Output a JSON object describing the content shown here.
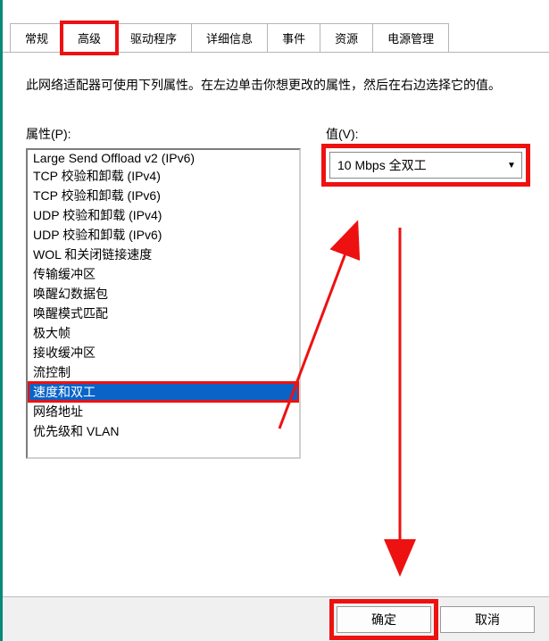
{
  "tabs": [
    {
      "label": "常规"
    },
    {
      "label": "高级"
    },
    {
      "label": "驱动程序"
    },
    {
      "label": "详细信息"
    },
    {
      "label": "事件"
    },
    {
      "label": "资源"
    },
    {
      "label": "电源管理"
    }
  ],
  "active_tab_index": 1,
  "description": "此网络适配器可使用下列属性。在左边单击你想更改的属性，然后在右边选择它的值。",
  "property_section_label": "属性(P):",
  "value_section_label": "值(V):",
  "property_items": [
    "Large Send Offload v2 (IPv6)",
    "TCP 校验和卸载 (IPv4)",
    "TCP 校验和卸载 (IPv6)",
    "UDP 校验和卸载 (IPv4)",
    "UDP 校验和卸载 (IPv6)",
    "WOL 和关闭链接速度",
    "传输缓冲区",
    "唤醒幻数据包",
    "唤醒模式匹配",
    "极大帧",
    "接收缓冲区",
    "流控制",
    "速度和双工",
    "网络地址",
    "优先级和 VLAN"
  ],
  "selected_property_index": 12,
  "value_selected": "10 Mbps 全双工",
  "buttons": {
    "ok": "确定",
    "cancel": "取消"
  },
  "annotation": {
    "highlight_color": "#e11",
    "arrow_color": "#e11"
  }
}
